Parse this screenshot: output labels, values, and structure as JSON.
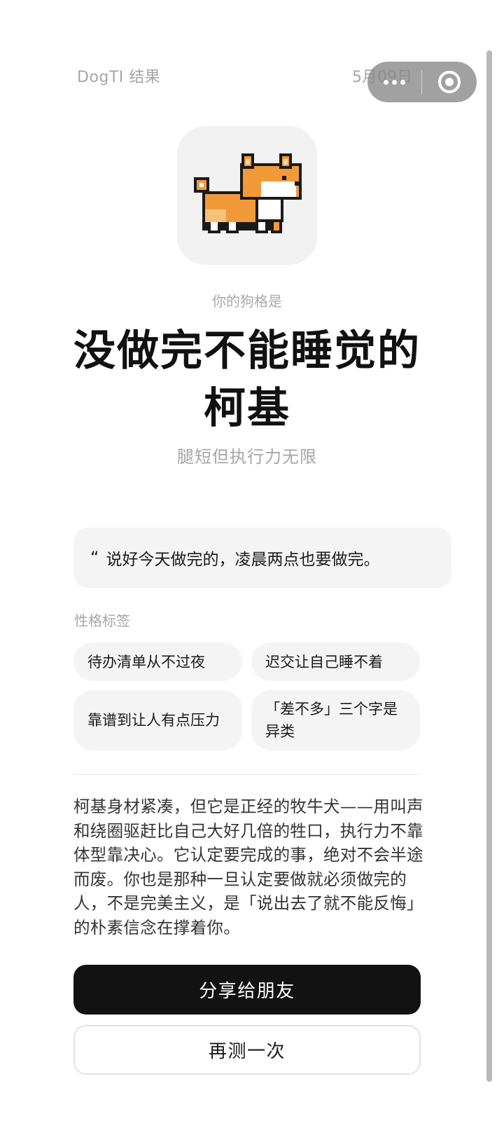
{
  "header": {
    "title": "DogTI 结果",
    "date": "5月09日"
  },
  "capsule": {
    "more_icon": "more-dots-icon",
    "close_icon": "target-circle-icon"
  },
  "avatar": {
    "icon": "pixel-corgi-icon"
  },
  "result": {
    "label": "你的狗格是",
    "name_line1": "没做完不能睡觉的",
    "name_line2": "柯基",
    "description": "腿短但执行力无限"
  },
  "quote": {
    "mark": "“",
    "text": "说好今天做完的，凌晨两点也要做完。"
  },
  "tags": {
    "label": "性格标签",
    "items": [
      "待办清单从不过夜",
      "迟交让自己睡不着",
      "靠谱到让人有点压力",
      "「差不多」三个字是异类"
    ]
  },
  "body": {
    "text": "柯基身材紧凑，但它是正经的牧牛犬——用叫声和绕圈驱赶比自己大好几倍的牲口，执行力不靠体型靠决心。它认定要完成的事，绝对不会半途而废。你也是那种一旦认定要做就必须做完的人，不是完美主义，是「说出去了就不能反悔」的朴素信念在撑着你。"
  },
  "actions": {
    "share_label": "分享给朋友",
    "retry_label": "再测一次"
  },
  "colors": {
    "primary_button": "#121212",
    "muted_text": "#a6a6a6",
    "card_bg": "#f4f4f4",
    "corgi_orange": "#f29a3a"
  }
}
